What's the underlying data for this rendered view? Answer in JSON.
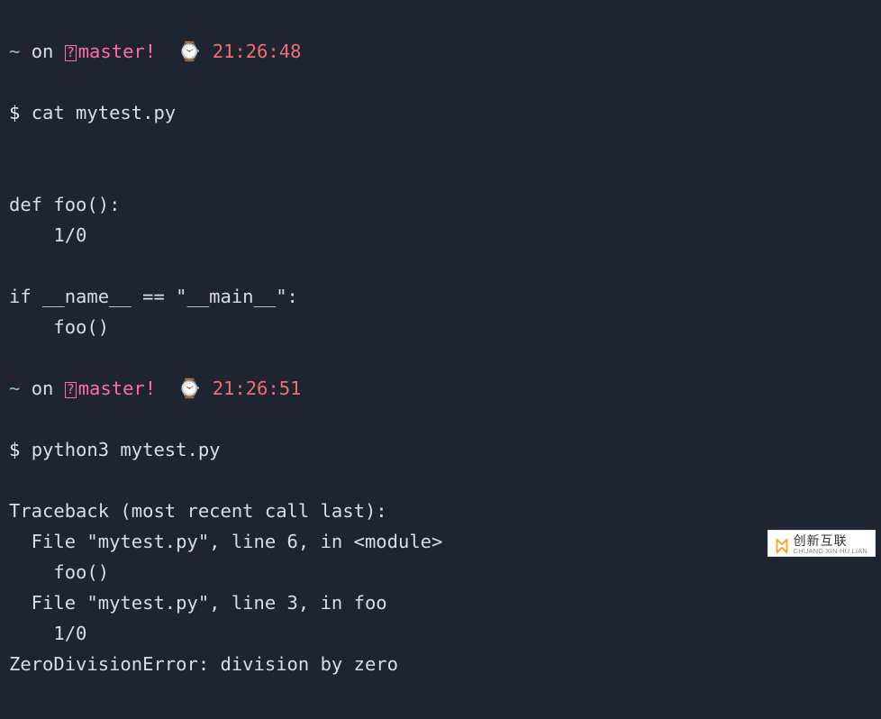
{
  "prompt1": {
    "tilde": "~",
    "on": "on",
    "branch_mark": "?",
    "branch": "master!",
    "clock": "⌚",
    "time": "21:26:48",
    "ps": "$",
    "cmd": "cat mytest.py"
  },
  "code": {
    "l1": "",
    "l2": "def foo():",
    "l3": "    1/0",
    "l4": "",
    "l5": "if __name__ == \"__main__\":",
    "l6": "    foo()"
  },
  "prompt2": {
    "tilde": "~",
    "on": "on",
    "branch_mark": "?",
    "branch": "master!",
    "clock": "⌚",
    "time": "21:26:51",
    "ps": "$",
    "cmd": "python3 mytest.py"
  },
  "trace": {
    "l1": "Traceback (most recent call last):",
    "l2": "  File \"mytest.py\", line 6, in <module>",
    "l3": "    foo()",
    "l4": "  File \"mytest.py\", line 3, in foo",
    "l5": "    1/0",
    "l6": "ZeroDivisionError: division by zero"
  },
  "watermark": {
    "zh": "创新互联",
    "en": "CHUANG XIN HU LIAN"
  }
}
